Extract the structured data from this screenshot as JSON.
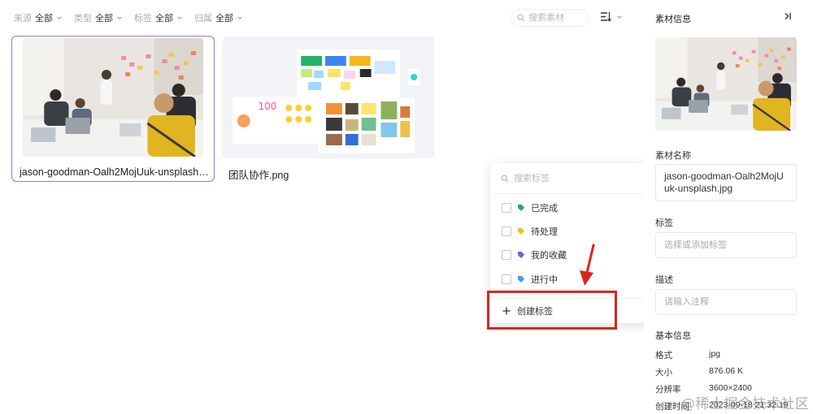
{
  "filters": [
    {
      "label": "来源",
      "value": "全部"
    },
    {
      "label": "类型",
      "value": "全部"
    },
    {
      "label": "标签",
      "value": "全部"
    },
    {
      "label": "归属",
      "value": "全部"
    }
  ],
  "search": {
    "placeholder": "搜索素材"
  },
  "assets": [
    {
      "name": "jason-goodman-Oalh2MojUuk-unsplash.jpg",
      "selected": true
    },
    {
      "name": "团队协作.png",
      "selected": false
    }
  ],
  "tag_dropdown": {
    "search_placeholder": "搜索标签",
    "tags": [
      {
        "label": "已完成",
        "color": "#1fae6a"
      },
      {
        "label": "待处理",
        "color": "#f3c21b"
      },
      {
        "label": "我的收藏",
        "color": "#6a5de8"
      },
      {
        "label": "进行中",
        "color": "#3d9cf0"
      }
    ],
    "create_label": "创建标签"
  },
  "panel": {
    "title": "素材信息",
    "name_label": "素材名称",
    "name_value": "jason-goodman-Oalh2MojUuk-unsplash.jpg",
    "tags_label": "标签",
    "tags_placeholder": "选择或添加标签",
    "desc_label": "描述",
    "desc_placeholder": "请输入注释",
    "basic_label": "基本信息",
    "info": [
      {
        "key": "格式",
        "value": "jpg"
      },
      {
        "key": "大小",
        "value": "876.06 K"
      },
      {
        "key": "分辨率",
        "value": "3600×2400"
      },
      {
        "key": "创建时间",
        "value": "2023-09-18 21:32:19"
      }
    ]
  },
  "watermark": "@稀土掘金技术社区",
  "colors": {
    "selection": "#8a7fde",
    "annotation": "#d9251e"
  }
}
